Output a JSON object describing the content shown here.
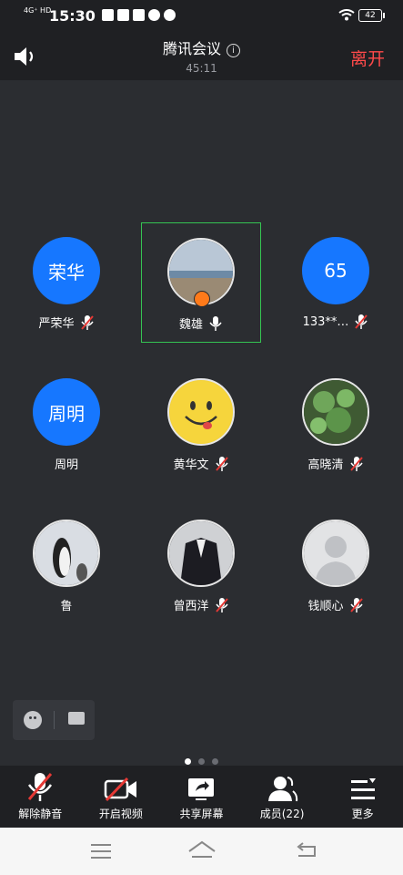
{
  "status": {
    "network": "4G⁺ HD",
    "time": "15:30",
    "battery": "42"
  },
  "header": {
    "title": "腾讯会议",
    "timer": "45:11",
    "leave": "离开"
  },
  "participants": [
    {
      "name": "严荣华",
      "avatar_text": "荣华",
      "avatar_type": "blue",
      "mic": "muted"
    },
    {
      "name": "魏雄",
      "avatar_text": "",
      "avatar_type": "photo-beach",
      "mic": "on",
      "host": true,
      "active": true
    },
    {
      "name": "133**…",
      "avatar_text": "65",
      "avatar_type": "blue",
      "mic": "muted"
    },
    {
      "name": "周明",
      "avatar_text": "周明",
      "avatar_type": "blue",
      "mic": "none"
    },
    {
      "name": "黄华文",
      "avatar_text": "",
      "avatar_type": "photo-smiley",
      "mic": "muted"
    },
    {
      "name": "高晓清",
      "avatar_text": "",
      "avatar_type": "photo-leaves",
      "mic": "muted"
    },
    {
      "name": "鲁",
      "avatar_text": "",
      "avatar_type": "photo-penguin",
      "mic": "none"
    },
    {
      "name": "曾西洋",
      "avatar_text": "",
      "avatar_type": "photo-suit",
      "mic": "muted"
    },
    {
      "name": "钱顺心",
      "avatar_text": "",
      "avatar_type": "photo-default",
      "mic": "muted"
    }
  ],
  "toolbar": {
    "unmute": "解除静音",
    "video": "开启视频",
    "share": "共享屏幕",
    "members": "成员(22)",
    "more": "更多"
  },
  "pager": {
    "pages": 3,
    "current": 0
  },
  "colors": {
    "accent_blue": "#1677ff",
    "leave_red": "#ff4a4a",
    "active_green": "#35c452",
    "mute_red": "#e53935"
  }
}
